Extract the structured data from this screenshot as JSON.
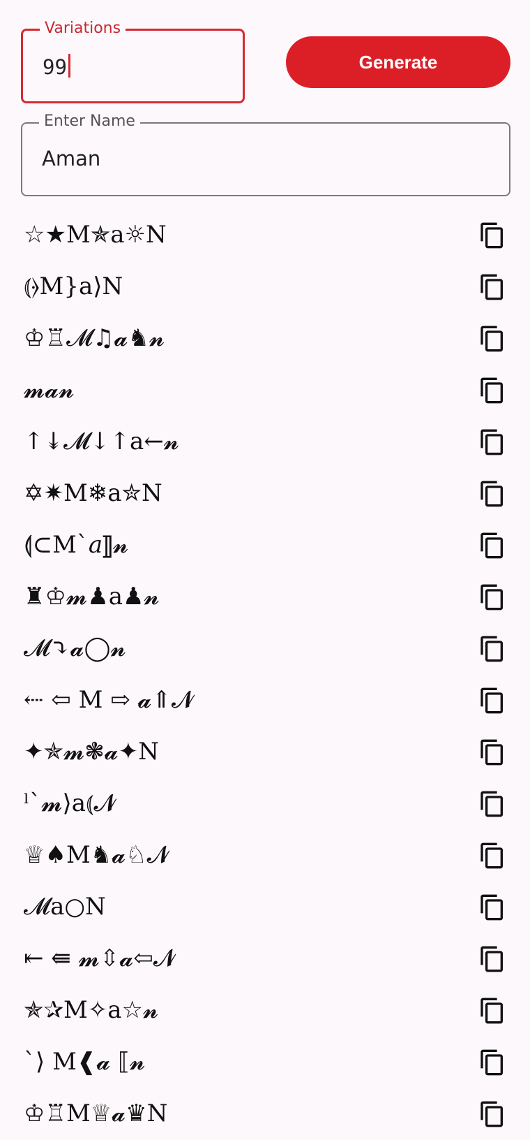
{
  "variations_field": {
    "label": "Variations",
    "value": "99"
  },
  "generate_button": {
    "label": "Generate"
  },
  "name_field": {
    "label": "Enter Name",
    "value": "Aman"
  },
  "results": [
    "☆★M✯a☼N",
    "⦅⦒M}a⟩N",
    "♔♖𝓜♫𝓪♞𝓷",
    "𝓶𝓪𝓷",
    "↑↡𝓜↓↑a←𝓷",
    "✡✷M❄a✮N",
    "⟬⊂Mˋ𝑎⟧𝓷",
    "♜♔𝓶♟a♟𝓷",
    "𝓜⤵𝓪◯𝓷",
    "⇠ ⇦ M ⇨ 𝓪⇑𝓝",
    "✦✯𝓶❃𝓪✦N",
    "ˡˋ𝓶⟩a⦅𝓝",
    "♕♠M♞𝓪♘𝓝",
    "𝓜a○N",
    "⇤ ⇚ 𝓶⇳𝓪⇦𝓝",
    "✯✰M✧a☆𝓷",
    "ˋ⟩ M❰𝓪 ⟦𝓷",
    "♔♖M♕𝓪♛N"
  ],
  "icons": {
    "copy": "copy-icon"
  },
  "colors": {
    "accent": "#dc1f27",
    "background": "#fdf8fb"
  }
}
